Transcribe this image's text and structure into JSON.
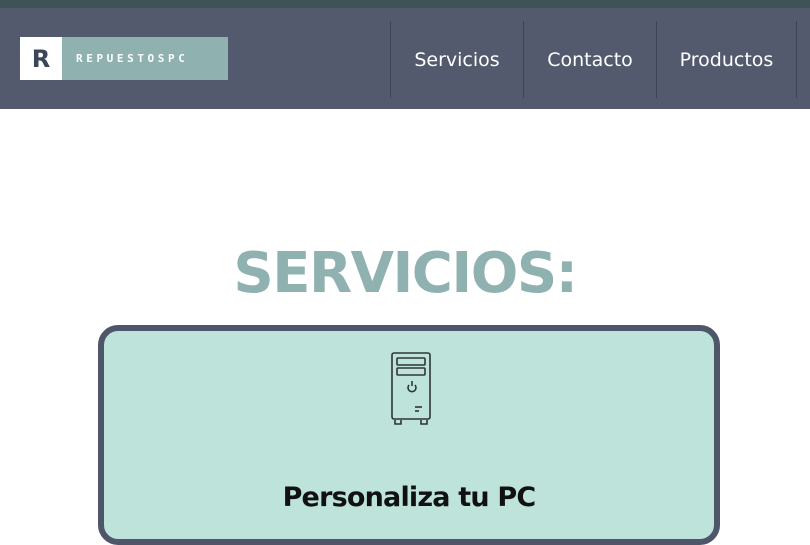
{
  "brand": {
    "logo_letter": "R",
    "logo_text": "REPUESTOSPC"
  },
  "nav": {
    "items": [
      {
        "label": "Servicios"
      },
      {
        "label": "Contacto"
      },
      {
        "label": "Productos"
      }
    ]
  },
  "main": {
    "title": "SERVICIOS:",
    "card": {
      "icon": "desktop-tower-icon",
      "title": "Personaliza tu PC"
    }
  },
  "colors": {
    "nav_background": "#535a6e",
    "accent": "#8fb1b0",
    "card_background": "#bde3db",
    "card_border": "#4f5669"
  }
}
